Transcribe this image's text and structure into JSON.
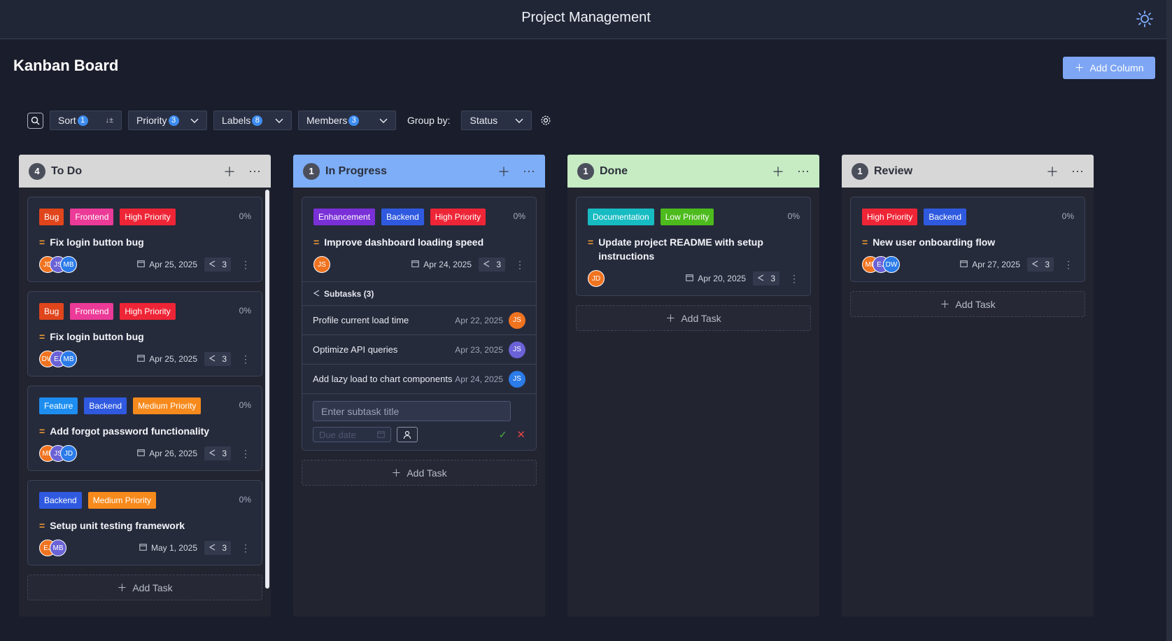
{
  "header": {
    "title": "Project Management",
    "theme_icon": "sun-icon"
  },
  "board": {
    "title": "Kanban Board",
    "add_column_label": "Add Column"
  },
  "toolbar": {
    "sort_label": "Sort",
    "sort_count": "1",
    "priority_label": "Priority",
    "priority_count": "3",
    "labels_label": "Labels",
    "labels_count": "8",
    "members_label": "Members",
    "members_count": "3",
    "group_by_label": "Group by:",
    "group_by_value": "Status"
  },
  "colors": {
    "Bug": "#e0451c",
    "Frontend": "#eb3a97",
    "High Priority": "#ee2536",
    "Feature": "#1d8ef0",
    "Backend": "#2f5ae0",
    "Medium Priority": "#f78a1c",
    "Enhancement": "#7a30d7",
    "Documentation": "#17bcc2",
    "Low Priority": "#4dbb1d",
    "todo_head": "#d7d7d7",
    "progress_head": "#7eaef8",
    "done_head": "#c7ecc4",
    "review_head": "#d7d7d7"
  },
  "columns": [
    {
      "name": "To Do",
      "count": "4",
      "cards": [
        {
          "tags": [
            "Bug",
            "Frontend",
            "High Priority"
          ],
          "progress": "0%",
          "title": "Fix login button bug",
          "avatars": [
            {
              "t": "JD",
              "c": "#f0731f"
            },
            {
              "t": "JS",
              "c": "#6a62d6"
            },
            {
              "t": "MB",
              "c": "#2b7be8"
            }
          ],
          "date": "Apr 25, 2025",
          "subtasks": "3"
        },
        {
          "tags": [
            "Bug",
            "Frontend",
            "High Priority"
          ],
          "progress": "0%",
          "title": "Fix login button bug",
          "avatars": [
            {
              "t": "DW",
              "c": "#f0731f"
            },
            {
              "t": "EJ",
              "c": "#6a62d6"
            },
            {
              "t": "MB",
              "c": "#2b7be8"
            }
          ],
          "date": "Apr 25, 2025",
          "subtasks": "3"
        },
        {
          "tags": [
            "Feature",
            "Backend",
            "Medium Priority"
          ],
          "progress": "0%",
          "title": "Add forgot password functionality",
          "avatars": [
            {
              "t": "MB",
              "c": "#f0731f"
            },
            {
              "t": "JS",
              "c": "#6a62d6"
            },
            {
              "t": "JD",
              "c": "#2b7be8"
            }
          ],
          "date": "Apr 26, 2025",
          "subtasks": "3"
        },
        {
          "tags": [
            "Backend",
            "Medium Priority"
          ],
          "progress": "0%",
          "title": "Setup unit testing framework",
          "avatars": [
            {
              "t": "EJ",
              "c": "#f0731f"
            },
            {
              "t": "MB",
              "c": "#6a62d6"
            }
          ],
          "date": "May 1, 2025",
          "subtasks": "3"
        }
      ],
      "add_task": "Add Task"
    },
    {
      "name": "In Progress",
      "count": "1",
      "cards": [
        {
          "tags": [
            "Enhancement",
            "Backend",
            "High Priority"
          ],
          "progress": "0%",
          "title": "Improve dashboard loading speed",
          "avatars": [
            {
              "t": "JS",
              "c": "#f0731f"
            }
          ],
          "date": "Apr 24, 2025",
          "subtasks": "3"
        }
      ],
      "subtasks": {
        "heading": "Subtasks (3)",
        "items": [
          {
            "title": "Profile current load time",
            "date": "Apr 22, 2025",
            "avatar": "JS",
            "color": "#f0731f"
          },
          {
            "title": "Optimize API queries",
            "date": "Apr 23, 2025",
            "avatar": "JS",
            "color": "#6a62d6"
          },
          {
            "title": "Add lazy load to chart components",
            "date": "Apr 24, 2025",
            "avatar": "JS",
            "color": "#2b7be8"
          }
        ],
        "input_placeholder": "Enter subtask title",
        "due_placeholder": "Due date"
      },
      "add_task": "Add Task"
    },
    {
      "name": "Done",
      "count": "1",
      "cards": [
        {
          "tags": [
            "Documentation",
            "Low Priority"
          ],
          "progress": "0%",
          "title": "Update project README with setup instructions",
          "avatars": [
            {
              "t": "JD",
              "c": "#f0731f"
            }
          ],
          "date": "Apr 20, 2025",
          "subtasks": "3"
        }
      ],
      "add_task": "Add Task"
    },
    {
      "name": "Review",
      "count": "1",
      "cards": [
        {
          "tags": [
            "High Priority",
            "Backend"
          ],
          "progress": "0%",
          "title": "New user onboarding flow",
          "avatars": [
            {
              "t": "MB",
              "c": "#f0731f"
            },
            {
              "t": "EJ",
              "c": "#6a62d6"
            },
            {
              "t": "DW",
              "c": "#2b7be8"
            }
          ],
          "date": "Apr 27, 2025",
          "subtasks": "3"
        }
      ],
      "add_task": "Add Task"
    }
  ]
}
